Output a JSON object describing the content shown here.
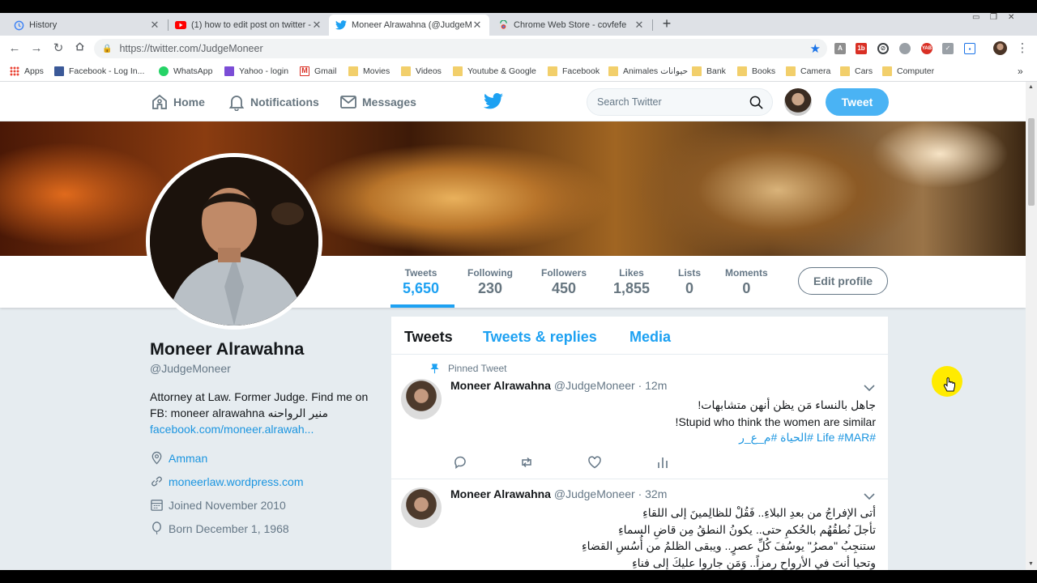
{
  "browser": {
    "tabs": [
      {
        "title": "History"
      },
      {
        "title": "(1) how to edit post on twitter - "
      },
      {
        "title": "Moneer Alrawahna (@JudgeMon"
      },
      {
        "title": "Chrome Web Store - covfefe"
      }
    ],
    "url": "https://twitter.com/JudgeMoneer",
    "bookmarks": [
      {
        "label": "Apps"
      },
      {
        "label": "Facebook - Log In..."
      },
      {
        "label": "WhatsApp"
      },
      {
        "label": "Yahoo - login"
      },
      {
        "label": "Gmail"
      },
      {
        "label": "Movies"
      },
      {
        "label": "Videos"
      },
      {
        "label": "Youtube & Google"
      },
      {
        "label": "Facebook"
      },
      {
        "label": "Animales حيوانات"
      },
      {
        "label": "Bank"
      },
      {
        "label": "Books"
      },
      {
        "label": "Camera"
      },
      {
        "label": "Cars"
      },
      {
        "label": "Computer"
      }
    ],
    "more_bookmarks": "»"
  },
  "twitter_nav": {
    "home": "Home",
    "notifications": "Notifications",
    "messages": "Messages",
    "search_placeholder": "Search Twitter",
    "tweet_button": "Tweet"
  },
  "stats": [
    {
      "label": "Tweets",
      "value": "5,650"
    },
    {
      "label": "Following",
      "value": "230"
    },
    {
      "label": "Followers",
      "value": "450"
    },
    {
      "label": "Likes",
      "value": "1,855"
    },
    {
      "label": "Lists",
      "value": "0"
    },
    {
      "label": "Moments",
      "value": "0"
    }
  ],
  "edit_profile": "Edit profile",
  "profile": {
    "name": "Moneer Alrawahna",
    "handle": "@JudgeMoneer",
    "bio": "Attorney at Law. Former Judge. Find me on FB: moneer alrawahna منير الرواحنه",
    "bio_link": "facebook.com/moneer.alrawah...",
    "location": "Amman",
    "website": "moneerlaw.wordpress.com",
    "joined": "Joined November 2010",
    "born": "Born December 1, 1968"
  },
  "timeline": {
    "tabs": [
      "Tweets",
      "Tweets & replies",
      "Media"
    ],
    "tweets": [
      {
        "pinned_label": "Pinned Tweet",
        "name": "Moneer Alrawahna",
        "handle": "@JudgeMoneer · 12m",
        "lines": [
          "جاهل بالنساء مَن يظن أنهن متشابهات!",
          "Stupid who think the women are similar!"
        ],
        "tags": "#Life #MAR #الحياة #م_ع_ر"
      },
      {
        "name": "Moneer Alrawahna",
        "handle": "@JudgeMoneer · 32m",
        "lines": [
          "أتى الإفراجُ من بعدِ البلاءِ.. فَقُلْ للظالِمينَ إلى اللقاءِ",
          "تأجلَ نُطقُهُم بالحُكمِ حتى.. يكونُ النطقُ مِن قاضِ السماءِ",
          "ستنجِبُ \"مصرُ\" يوسُفَ كُلِّ عصرٍ.. ويبقى الظلمُ من أُسُسِ القضاءِ",
          "وتحيا أنتَ في الأرواحِ رمزاً.. وَمَن جاروا عليكَ إلى فناءِ"
        ]
      }
    ]
  },
  "colors": {
    "twitter_blue": "#1da1f2",
    "tweet_button": "#4ab3f4",
    "link": "#1b95e0",
    "page_bg": "#e6ecf0"
  }
}
